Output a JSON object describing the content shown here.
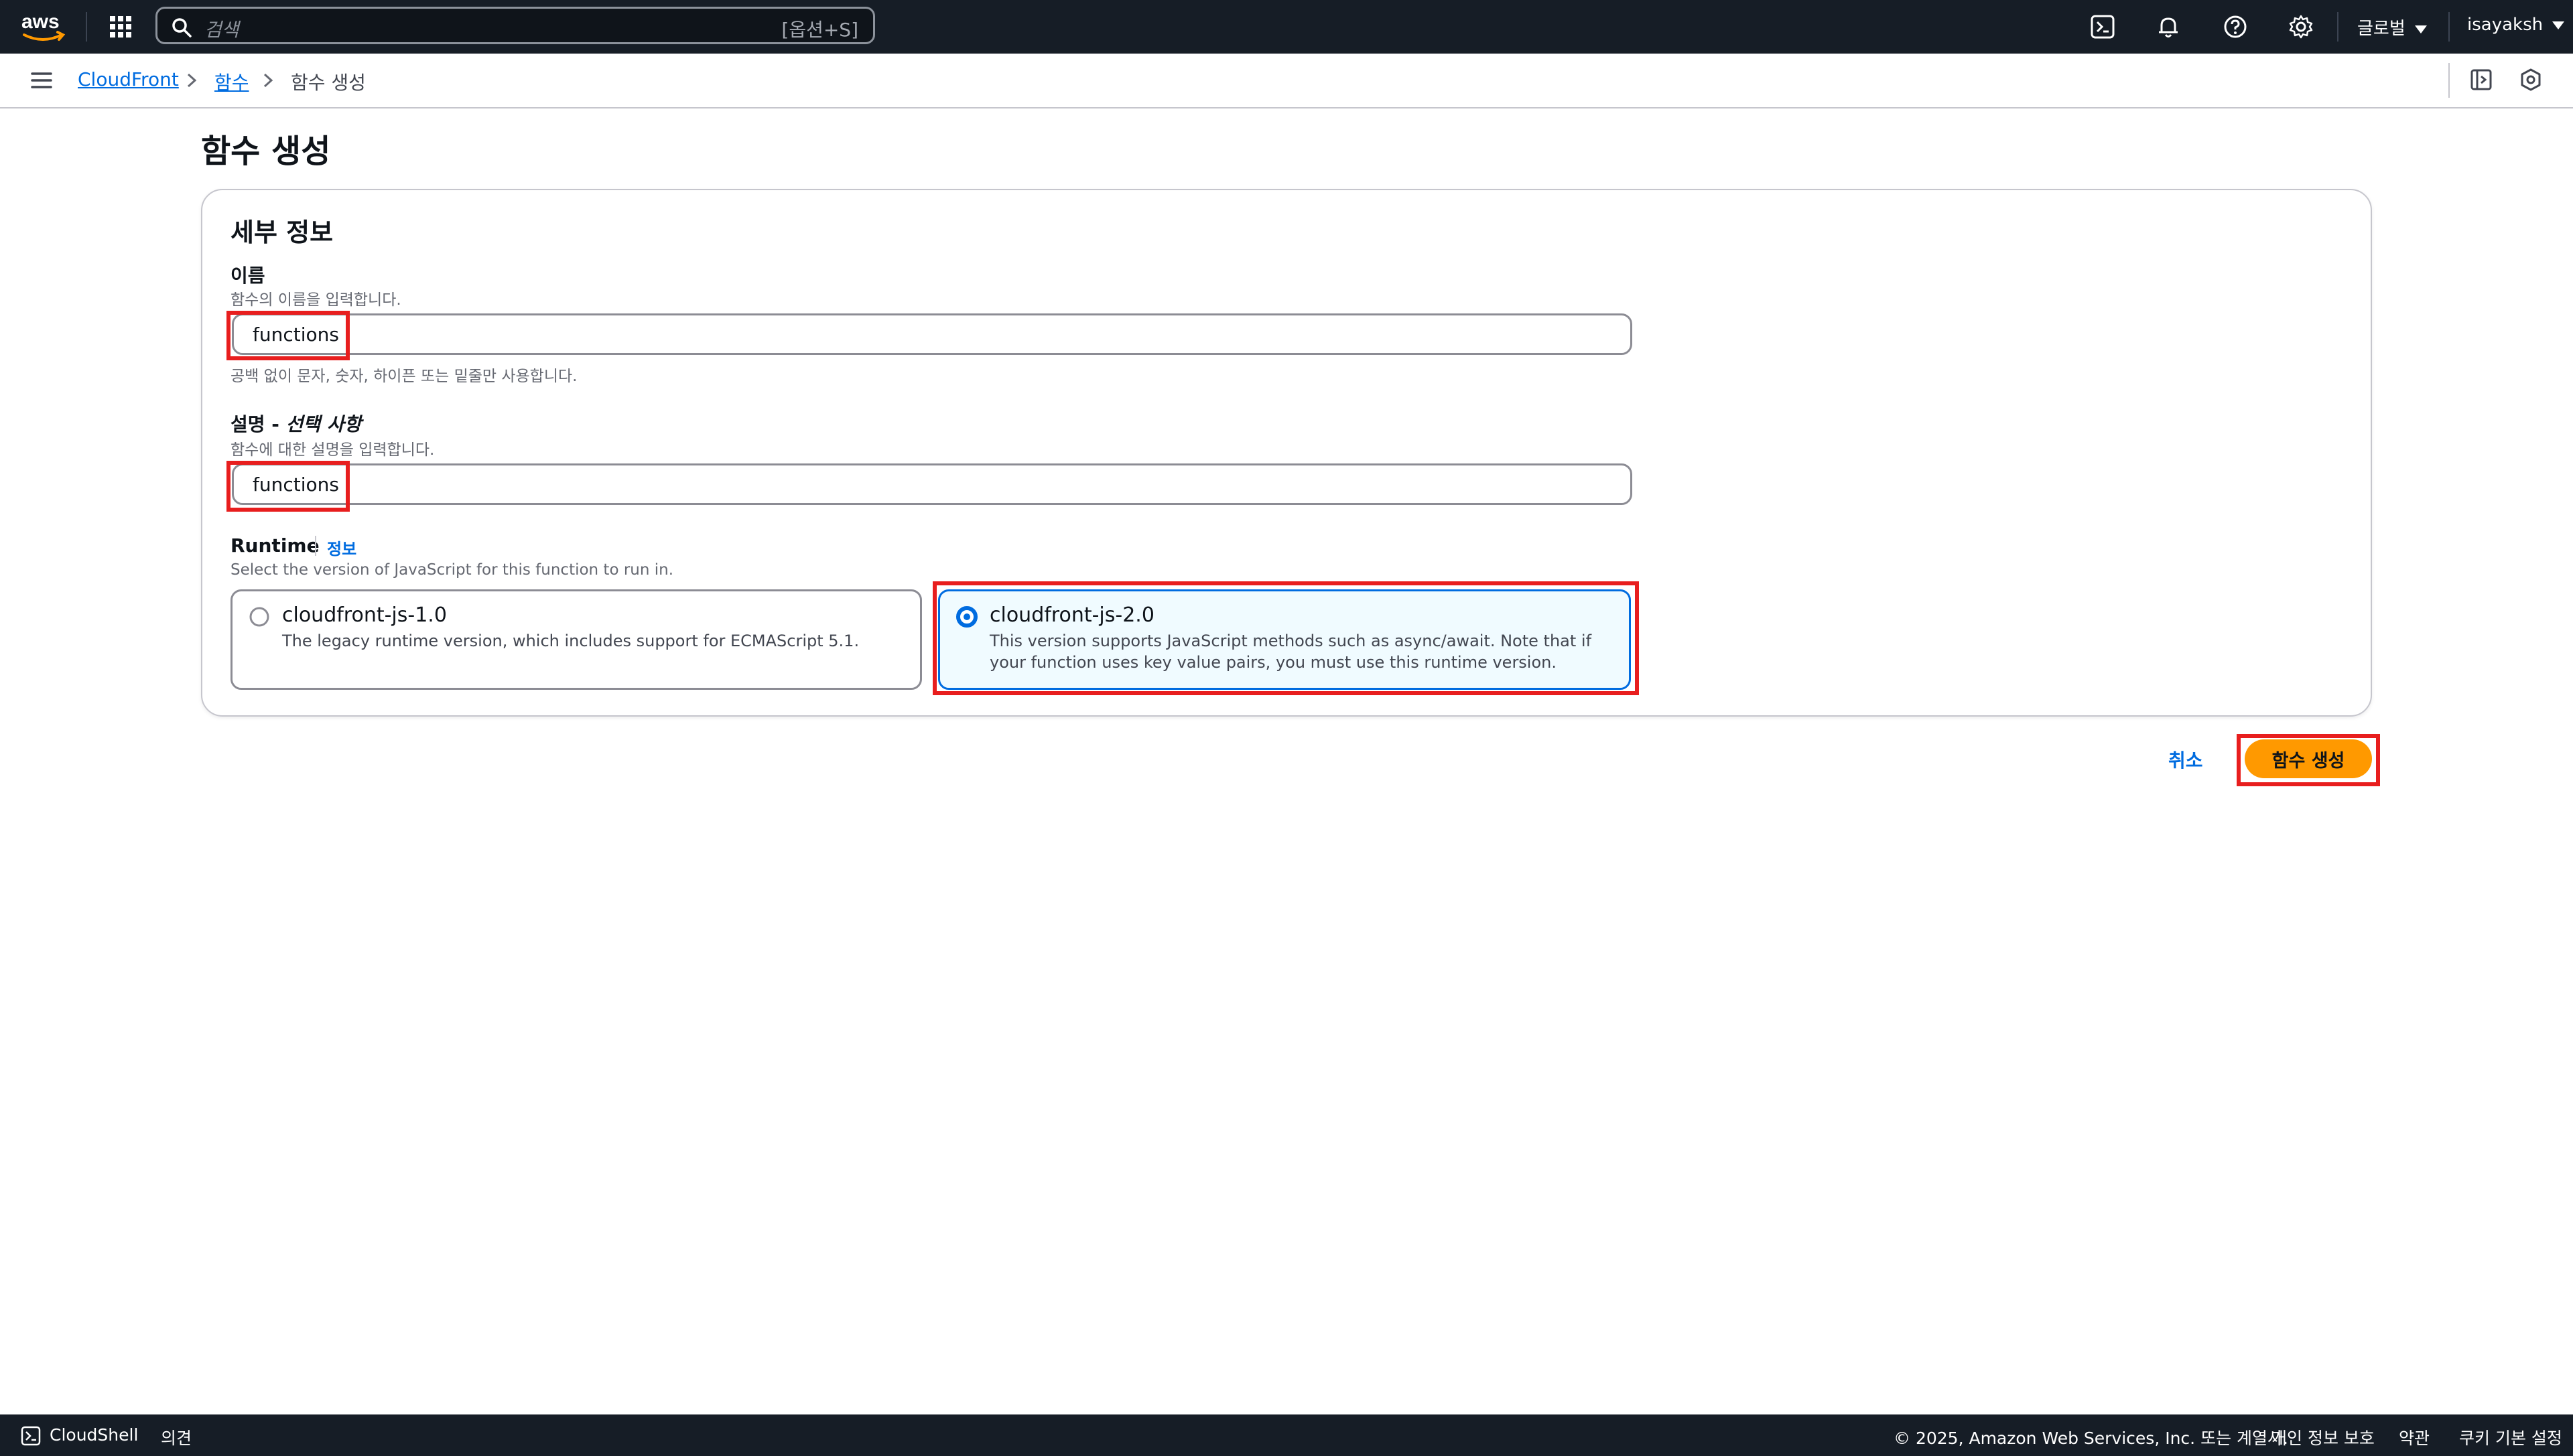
{
  "topnav": {
    "search_placeholder": "검색",
    "search_shortcut": "[옵션+S]",
    "region": "글로벌",
    "user": "isayaksh"
  },
  "breadcrumb": {
    "items": [
      "CloudFront",
      "함수"
    ],
    "current": "함수 생성"
  },
  "page": {
    "title": "함수 생성"
  },
  "details": {
    "title": "세부 정보",
    "name_label": "이름",
    "name_desc": "함수의 이름을 입력합니다.",
    "name_value": "functions",
    "name_constraint": "공백 없이 문자, 숫자, 하이픈 또는 밑줄만 사용합니다.",
    "desc_label": "설명 -",
    "desc_label_optional": "선택 사항",
    "desc_desc": "함수에 대한 설명을 입력합니다.",
    "desc_value": "functions",
    "runtime_label": "Runtime",
    "runtime_info": "정보",
    "runtime_desc": "Select the version of JavaScript for this function to run in.",
    "runtime_options": [
      {
        "title": "cloudfront-js-1.0",
        "desc": "The legacy runtime version, which includes support for ECMAScript 5.1.",
        "selected": false
      },
      {
        "title": "cloudfront-js-2.0",
        "desc": "This version supports JavaScript methods such as async/await. Note that if your function uses key value pairs, you must use this runtime version.",
        "selected": true
      }
    ]
  },
  "actions": {
    "cancel": "취소",
    "create": "함수 생성"
  },
  "footer": {
    "cloudshell": "CloudShell",
    "feedback": "의견",
    "copyright": "© 2025, Amazon Web Services, Inc. 또는 계열사.",
    "privacy": "개인 정보 보호",
    "terms": "약관",
    "cookies": "쿠키 기본 설정"
  },
  "colors": {
    "nav_bg": "#161d26",
    "link": "#006ce0",
    "primary": "#ff9900",
    "highlight": "#e81e1e",
    "selected_tile_bg": "#f0fbff"
  }
}
